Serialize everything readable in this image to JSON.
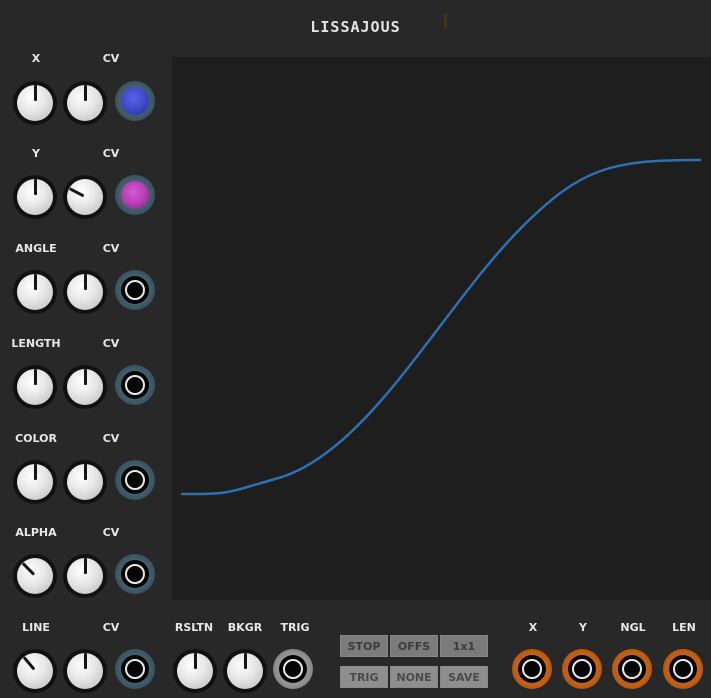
{
  "module": {
    "title": "LISSAJOUS"
  },
  "rows": [
    {
      "label": "X",
      "cv_label": "CV",
      "jack_color": "#3f46c8"
    },
    {
      "label": "Y",
      "cv_label": "CV",
      "jack_color": "#b13cb0"
    },
    {
      "label": "ANGLE",
      "cv_label": "CV"
    },
    {
      "label": "LENGTH",
      "cv_label": "CV"
    },
    {
      "label": "COLOR",
      "cv_label": "CV"
    },
    {
      "label": "ALPHA",
      "cv_label": "CV"
    }
  ],
  "bottom": {
    "line_label": "LINE",
    "cv_label": "CV",
    "rsltn_label": "RSLTN",
    "bkgr_label": "BKGR",
    "trig_label": "TRIG",
    "buttons": [
      "STOP",
      "OFFS",
      "1x1",
      "TRIG",
      "NONE",
      "SAVE"
    ],
    "outputs": [
      "X",
      "Y",
      "NGL",
      "LEN"
    ]
  },
  "display": {
    "curve_color": "#2f6fb3",
    "background": "#1e1e1e"
  }
}
